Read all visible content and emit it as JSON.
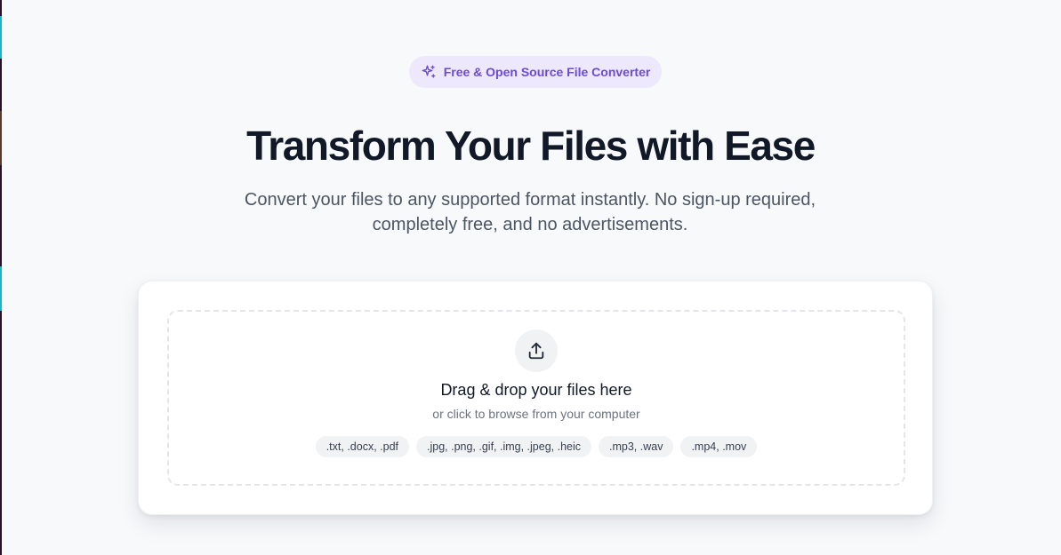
{
  "badge": {
    "icon": "sparkles-icon",
    "label": "Free & Open Source File Converter",
    "color": "#6d4ad8"
  },
  "hero": {
    "title": "Transform Your Files with Ease",
    "subtitle": "Convert your files to any supported format instantly. No sign-up required, completely free, and no advertisements."
  },
  "upload": {
    "icon": "upload-icon",
    "title": "Drag & drop your files here",
    "subtitle": "or click to browse from your computer",
    "formats": [
      ".txt, .docx, .pdf",
      ".jpg, .png, .gif, .img, .jpeg, .heic",
      ".mp3, .wav",
      ".mp4, .mov"
    ]
  }
}
